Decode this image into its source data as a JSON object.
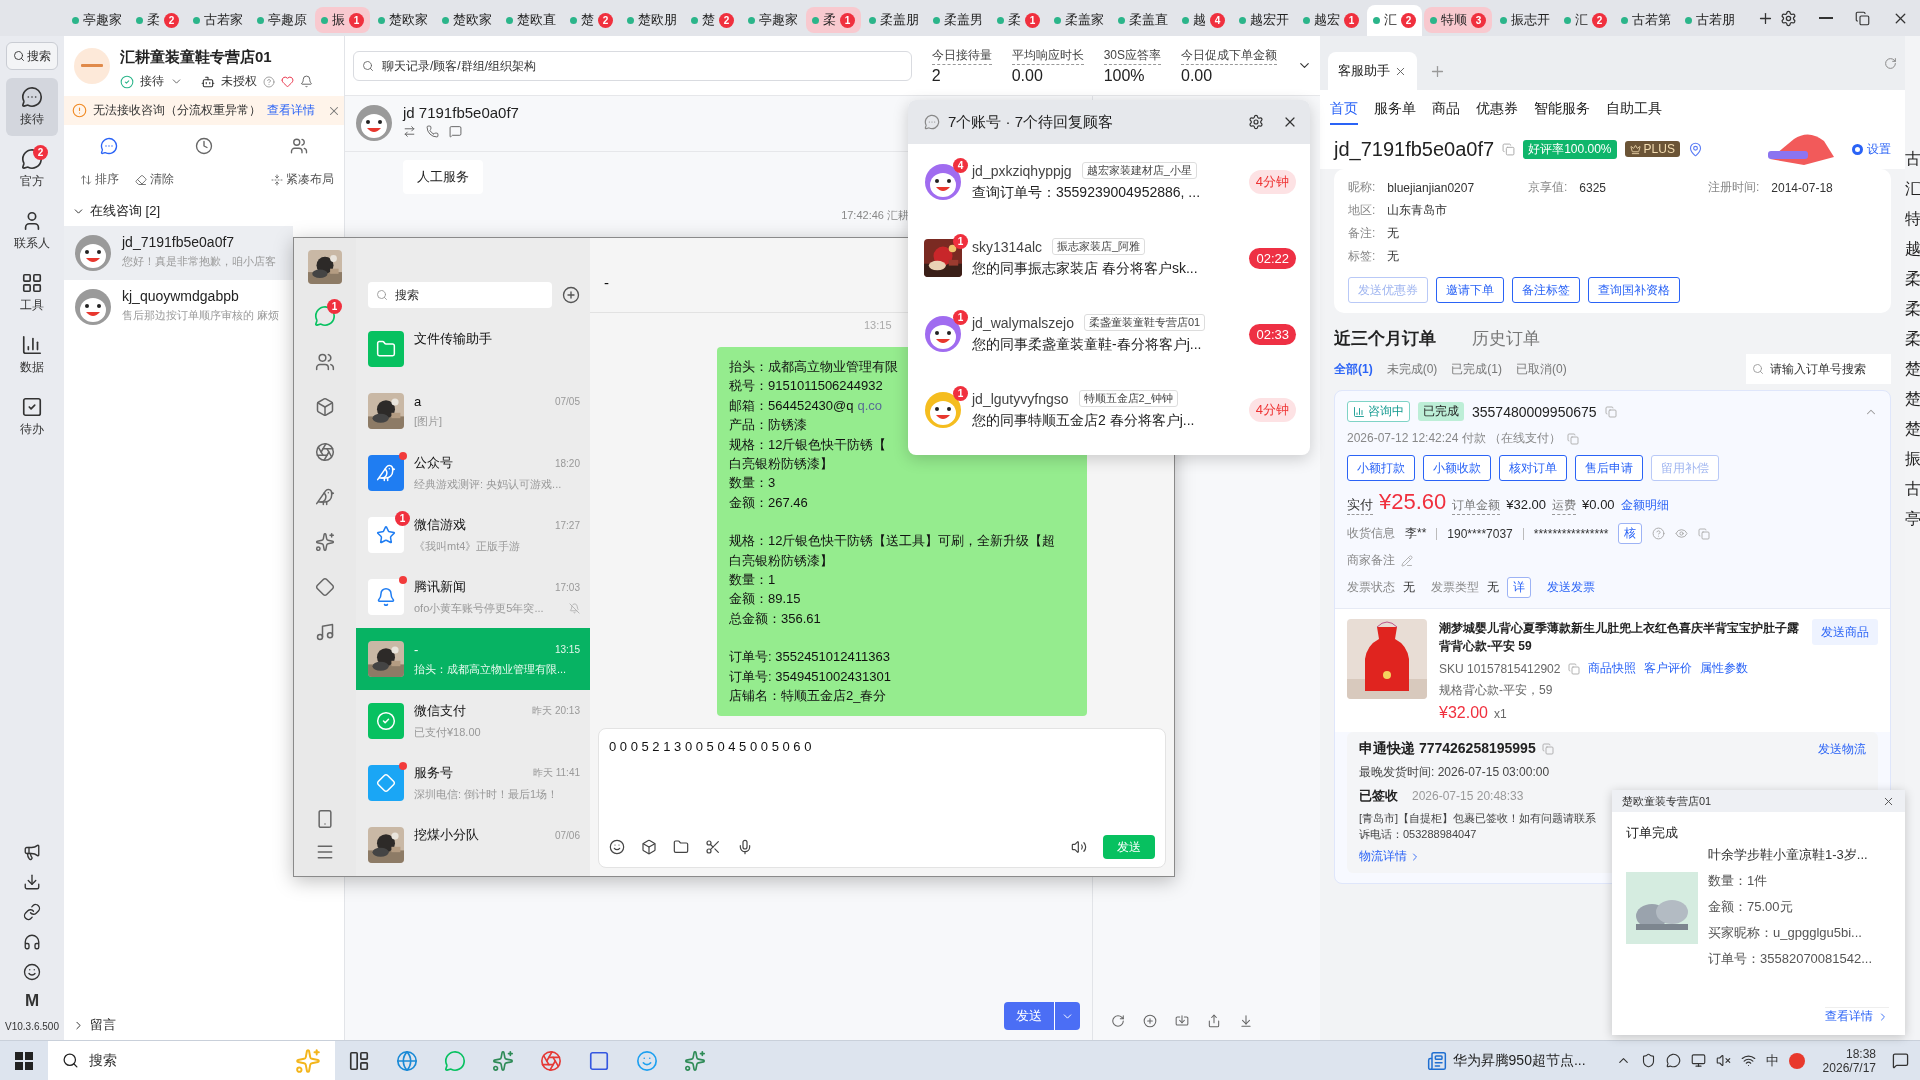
{
  "app_tabs": [
    {
      "label": "亭趣家",
      "selected": false,
      "alert": false
    },
    {
      "label": "柔",
      "badge": "2",
      "selected": false,
      "alert": false
    },
    {
      "label": "古若家",
      "selected": false,
      "alert": false
    },
    {
      "label": "亭趣原",
      "selected": false,
      "alert": false
    },
    {
      "label": "振",
      "badge": "1",
      "selected": false,
      "alert": true
    },
    {
      "label": "楚欧家",
      "selected": false,
      "alert": false
    },
    {
      "label": "楚欧家",
      "selected": false,
      "alert": false
    },
    {
      "label": "楚欧直",
      "selected": false,
      "alert": false
    },
    {
      "label": "楚",
      "badge": "2",
      "selected": false,
      "alert": false
    },
    {
      "label": "楚欧朋",
      "selected": false,
      "alert": false
    },
    {
      "label": "楚",
      "badge": "2",
      "selected": false,
      "alert": false
    },
    {
      "label": "亭趣家",
      "selected": false,
      "alert": false
    },
    {
      "label": "柔",
      "badge": "1",
      "selected": false,
      "alert": true
    },
    {
      "label": "柔盖朋",
      "selected": false,
      "alert": false
    },
    {
      "label": "柔盖男",
      "selected": false,
      "alert": false
    },
    {
      "label": "柔",
      "badge": "1",
      "selected": false,
      "alert": false
    },
    {
      "label": "柔盖家",
      "selected": false,
      "alert": false
    },
    {
      "label": "柔盖直",
      "selected": false,
      "alert": false
    },
    {
      "label": "越",
      "badge": "4",
      "selected": false,
      "alert": false
    },
    {
      "label": "越宏开",
      "selected": false,
      "alert": false
    },
    {
      "label": "越宏",
      "badge": "1",
      "selected": false,
      "alert": false
    },
    {
      "label": "汇",
      "badge": "2",
      "selected": true,
      "alert": false
    },
    {
      "label": "特顺",
      "badge": "3",
      "selected": false,
      "alert": true
    },
    {
      "label": "振志开",
      "selected": false,
      "alert": false
    },
    {
      "label": "汇",
      "badge": "2",
      "selected": false,
      "alert": false
    },
    {
      "label": "古若第",
      "selected": false,
      "alert": false
    },
    {
      "label": "古若朋",
      "selected": false,
      "alert": false
    }
  ],
  "rail": {
    "search": "搜索",
    "items": [
      {
        "label": "接待",
        "selected": true
      },
      {
        "label": "官方",
        "badge": "2",
        "selected": false
      },
      {
        "label": "联系人",
        "selected": false
      },
      {
        "label": "工具",
        "selected": false
      },
      {
        "label": "数据",
        "selected": false
      },
      {
        "label": "待办",
        "selected": false
      }
    ],
    "letter": "M",
    "version": "V10.3.6.500"
  },
  "store": {
    "name": "汇耕童装童鞋专营店01",
    "status": "接待",
    "auth": "未授权"
  },
  "warning": {
    "text": "无法接收咨询（分流权重异常）",
    "link": "查看详情"
  },
  "session_tabs": [
    {
      "selected": true
    },
    {
      "selected": false
    },
    {
      "selected": false
    }
  ],
  "session_tools": [
    "排序",
    "清除",
    "紧凑布局"
  ],
  "group": {
    "label": "在线咨询 [2]",
    "expanded": true
  },
  "sessions": [
    {
      "name": "jd_7191fb5e0a0f7",
      "preview": "您好！真是非常抱歉，咱小店客",
      "selected": true
    },
    {
      "name": "kj_quoywmdgabpb",
      "preview": "售后那边按订单顺序审核的 麻烦",
      "selected": false
    }
  ],
  "leave_message": "留言",
  "chat": {
    "search_placeholder": "聊天记录/顾客/群组/组织架构",
    "stats": [
      {
        "label": "今日接待量",
        "value": "2"
      },
      {
        "label": "平均响应时长",
        "value": "0.00"
      },
      {
        "label": "30S应答率",
        "value": "100%"
      },
      {
        "label": "今日促成下单金额",
        "value": "0.00"
      }
    ],
    "customer": "jd 7191fb5e0a0f7",
    "message": "人工服务",
    "time_line": "17:42:46 汇耕",
    "send": "发送"
  },
  "pending_popup": {
    "title": "7个账号 · 7个待回复顾客",
    "items": [
      {
        "name": "jd_pxkziqhyppjg",
        "store": "越宏家装建材店_小星",
        "message": "查询订单号：3559239004952886, ...",
        "badge": "4",
        "time": "4分钟",
        "urgent": false,
        "kind": "mascot",
        "color": "#a06cf0"
      },
      {
        "name": "sky1314alc",
        "store": "振志家装店_阿雅",
        "message": "您的同事振志家装店  春分将客户sk...",
        "badge": "1",
        "time": "02:22",
        "urgent": true,
        "kind": "picture"
      },
      {
        "name": "jd_walymalszejo",
        "store": "柔盏童装童鞋专营店01",
        "message": "您的同事柔盏童装童鞋-春分将客户j...",
        "badge": "1",
        "time": "02:33",
        "urgent": true,
        "kind": "mascot",
        "color": "#a06cf0"
      },
      {
        "name": "jd_lgutyvyfngso",
        "store": "特顺五金店2_钟钟",
        "message": "您的同事特顺五金店2  春分将客户j...",
        "badge": "1",
        "time": "4分钟",
        "urgent": false,
        "kind": "mascot",
        "color": "#f5bd1f"
      }
    ]
  },
  "wechat": {
    "search_placeholder": "搜索",
    "nav_badge": "1",
    "chats": [
      {
        "name": "文件传输助手",
        "kind": "file",
        "selected": false
      },
      {
        "name": "a",
        "time": "07/05",
        "preview": "[图片]",
        "kind": "picture",
        "selected": false
      },
      {
        "name": "公众号",
        "time": "18:20",
        "preview": "经典游戏测评: 央妈认可游戏...",
        "kind": "official",
        "dot": true,
        "selected": false
      },
      {
        "name": "微信游戏",
        "time": "17:27",
        "preview": "《我叫mt4》正版手游",
        "kind": "game",
        "badge": "1",
        "selected": false
      },
      {
        "name": "腾讯新闻",
        "time": "17:03",
        "preview": "ofo小黄车账号停更5年突...",
        "kind": "news",
        "dot": true,
        "muted": true,
        "selected": false
      },
      {
        "name": "-",
        "time": "13:15",
        "preview": "抬头：成都高立物业管理有限...",
        "kind": "picture",
        "selected": true
      },
      {
        "name": "微信支付",
        "time": "昨天 20:13",
        "preview": "已支付¥18.00",
        "kind": "pay",
        "selected": false
      },
      {
        "name": "服务号",
        "time": "昨天 11:41",
        "preview": "深圳电信: 倒计时！最后1场！",
        "kind": "service",
        "dot": true,
        "selected": false
      },
      {
        "name": "挖煤小分队",
        "time": "07/06",
        "kind": "picture",
        "selected": false
      }
    ],
    "title": "-",
    "time": "13:15",
    "bubble": [
      [
        "抬头：成都高立物业管理有限",
        "税号：9151011506244932",
        "邮箱：564452430@q",
        "产品：防锈漆",
        "规格：12斤银色快干防锈【",
        "白亮银粉防锈漆】",
        "数量：3",
        "金额：267.46"
      ],
      [
        "规格：12斤银色快干防锈【送工具】可刷，全新升级【超",
        "白亮银粉防锈漆】",
        "数量：1",
        "金额：89.15",
        "总金额：356.61"
      ],
      [
        "订单号: 3552451012411363",
        "订单号: 3549451002431301",
        "店铺名：特顺五金店2_春分"
      ]
    ],
    "bubble_link": "q.co",
    "input": "0 0 0 5 2 1 3 0 0 5 0 4 5 0 0 5 0 6 0",
    "send": "发送"
  },
  "assistant": {
    "tab": "客服助手",
    "nav": [
      {
        "label": "首页",
        "selected": true
      },
      {
        "label": "服务单",
        "selected": false
      },
      {
        "label": "商品",
        "selected": false
      },
      {
        "label": "优惠券",
        "selected": false
      },
      {
        "label": "智能服务",
        "selected": false
      },
      {
        "label": "自助工具",
        "selected": false
      }
    ],
    "customer": "jd_7191fb5e0a0f7",
    "rating": "好评率100.00%",
    "plus": "PLUS",
    "settings": "设置",
    "settings_on": true,
    "info": [
      {
        "label": "昵称:",
        "value": "bluejianjian0207"
      },
      {
        "label": "京享值:",
        "value": "6325"
      },
      {
        "label": "注册时间:",
        "value": "2014-07-18"
      },
      {
        "label": "地区:",
        "value": "山东青岛市"
      },
      {
        "label": "备注:",
        "value": "无"
      },
      {
        "label": "标签:",
        "value": "无"
      }
    ],
    "actions": [
      {
        "label": "发送优惠券",
        "disabled": true
      },
      {
        "label": "邀请下单",
        "disabled": false
      },
      {
        "label": "备注标签",
        "disabled": false
      },
      {
        "label": "查询国补资格",
        "disabled": false
      }
    ],
    "order_tabs": [
      {
        "label": "近三个月订单",
        "selected": true
      },
      {
        "label": "历史订单",
        "selected": false
      }
    ],
    "filters": [
      {
        "label": "全部(1)",
        "selected": true
      },
      {
        "label": "未完成(0)",
        "selected": false
      },
      {
        "label": "已完成(1)",
        "selected": false
      },
      {
        "label": "已取消(0)",
        "selected": false
      }
    ],
    "order_search_placeholder": "请输入订单号搜索",
    "order": {
      "consult": "咨询中",
      "status": "已完成",
      "number": "3557480009950675",
      "paid_at": "2026-07-12 12:42:24  付款 （在线支付）",
      "buttons": [
        {
          "label": "小额打款",
          "disabled": false
        },
        {
          "label": "小额收款",
          "disabled": false
        },
        {
          "label": "核对订单",
          "disabled": false
        },
        {
          "label": "售后申请",
          "disabled": false
        },
        {
          "label": "留用补偿",
          "disabled": true
        }
      ],
      "paid_label": "实付",
      "paid": "¥25.60",
      "amount_label": "订单金额",
      "amount": "¥32.00",
      "freight_label": "运费",
      "freight": "¥0.00",
      "detail_link": "金额明细",
      "receiver_label": "收货信息",
      "receiver": "李**",
      "phone": "190****7037",
      "address": "****************",
      "verify": "核",
      "remark_label": "商家备注",
      "invoice_status_label": "发票状态",
      "invoice_status": "无",
      "invoice_type_label": "发票类型",
      "invoice_type": "无",
      "invoice_detail": "详",
      "send_invoice": "发送发票",
      "product": {
        "title": "潮梦城婴儿背心夏季薄款新生儿肚兜上衣红色喜庆半背宝宝护肚子露背背心款-平安 59",
        "send": "发送商品",
        "sku": "SKU 10157815412902",
        "links": [
          "商品快照",
          "客户评价",
          "属性参数"
        ],
        "spec": "规格背心款-平安，59",
        "price": "¥32.00",
        "qty": "x1"
      },
      "logistics": {
        "title": "申通快递 777426258195995",
        "send": "发送物流",
        "deadline": "最晚发货时间:   2026-07-15 03:00:00",
        "signed": "已签收",
        "signed_at": "2026-07-15 20:48:33",
        "lines": [
          "[青岛市]【自提柜】包裹已签收！如有问题请联系",
          "诉电话：053288984047"
        ],
        "detail": "物流详情"
      }
    }
  },
  "side_strip": [
    "古",
    "汇",
    "特",
    "越",
    "柔",
    "柔",
    "柔",
    "楚",
    "楚",
    "楚",
    "振",
    "古",
    "亭"
  ],
  "toast": {
    "store": "楚欧童装专营店01",
    "title": "订单完成",
    "product": "叶余学步鞋小童凉鞋1-3岁...",
    "lines": [
      "数量：1件",
      "金额：75.00元",
      "买家昵称：u_gpgglgu5bi...",
      "订单号：35582070081542..."
    ],
    "link": "查看详情"
  },
  "taskbar": {
    "search": "搜索",
    "news": "华为昇腾950超节点...",
    "ime": "中",
    "time": "18:38",
    "date": "2026/7/17"
  }
}
